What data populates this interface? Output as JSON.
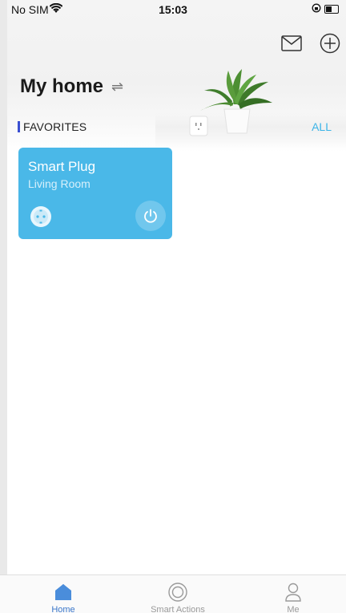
{
  "status_bar": {
    "carrier": "No SIM",
    "time": "15:03"
  },
  "header": {
    "title": "My home"
  },
  "favorites": {
    "label": "FAVORITES",
    "all_link": "ALL"
  },
  "devices": [
    {
      "name": "Smart Plug",
      "room": "Living Room"
    }
  ],
  "tabbar": {
    "items": [
      {
        "label": "Home",
        "active": true
      },
      {
        "label": "Smart Actions",
        "active": false
      },
      {
        "label": "Me",
        "active": false
      }
    ]
  },
  "colors": {
    "accent": "#3bb4e8",
    "card": "#4ab8e8",
    "tab_active": "#3a76c9",
    "favorites_bar": "#3a4fd1"
  },
  "icons": {
    "mail": "mail-icon",
    "add": "add-circle-icon",
    "switch": "switch-home-icon",
    "plug": "plug-socket-icon",
    "power": "power-icon",
    "home": "home-icon",
    "smart_actions": "smart-actions-icon",
    "me": "user-icon"
  }
}
